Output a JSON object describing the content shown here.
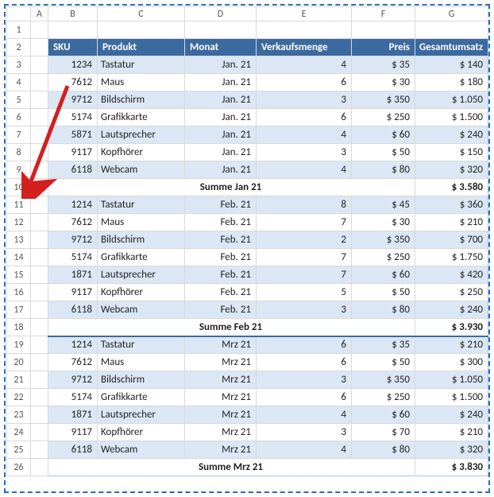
{
  "columns": [
    "A",
    "B",
    "C",
    "D",
    "E",
    "F",
    "G"
  ],
  "header": {
    "sku": "SKU",
    "produkt": "Produkt",
    "monat": "Monat",
    "menge": "Verkaufsmenge",
    "preis": "Preis",
    "umsatz": "Gesamtumsatz"
  },
  "rows": [
    {
      "n": 3,
      "sku": "1234",
      "produkt": "Tastatur",
      "monat": "Jan. 21",
      "menge": "4",
      "preis": "$ 35",
      "umsatz": "$ 140"
    },
    {
      "n": 4,
      "sku": "7612",
      "produkt": "Maus",
      "monat": "Jan. 21",
      "menge": "6",
      "preis": "$ 30",
      "umsatz": "$ 180"
    },
    {
      "n": 5,
      "sku": "9712",
      "produkt": "Bildschirm",
      "monat": "Jan. 21",
      "menge": "3",
      "preis": "$ 350",
      "umsatz": "$ 1.050"
    },
    {
      "n": 6,
      "sku": "5174",
      "produkt": "Grafikkarte",
      "monat": "Jan. 21",
      "menge": "6",
      "preis": "$ 250",
      "umsatz": "$ 1.500"
    },
    {
      "n": 7,
      "sku": "5871",
      "produkt": "Lautsprecher",
      "monat": "Jan. 21",
      "menge": "4",
      "preis": "$ 60",
      "umsatz": "$ 240"
    },
    {
      "n": 8,
      "sku": "9117",
      "produkt": "Kopfhörer",
      "monat": "Jan. 21",
      "menge": "3",
      "preis": "$ 50",
      "umsatz": "$ 150"
    },
    {
      "n": 9,
      "sku": "6118",
      "produkt": "Webcam",
      "monat": "Jan. 21",
      "menge": "4",
      "preis": "$ 80",
      "umsatz": "$ 320"
    },
    {
      "n": 10,
      "subtotal": true,
      "label": "Summe Jan 21",
      "umsatz": "$ 3.580"
    },
    {
      "n": 11,
      "sku": "1214",
      "produkt": "Tastatur",
      "monat": "Feb. 21",
      "menge": "8",
      "preis": "$ 45",
      "umsatz": "$ 360"
    },
    {
      "n": 12,
      "sku": "7612",
      "produkt": "Maus",
      "monat": "Feb. 21",
      "menge": "7",
      "preis": "$ 30",
      "umsatz": "$ 210"
    },
    {
      "n": 13,
      "sku": "9712",
      "produkt": "Bildschirm",
      "monat": "Feb. 21",
      "menge": "2",
      "preis": "$ 350",
      "umsatz": "$ 700"
    },
    {
      "n": 14,
      "sku": "5174",
      "produkt": "Grafikkarte",
      "monat": "Feb. 21",
      "menge": "7",
      "preis": "$ 250",
      "umsatz": "$ 1.750"
    },
    {
      "n": 15,
      "sku": "1871",
      "produkt": "Lautsprecher",
      "monat": "Feb. 21",
      "menge": "7",
      "preis": "$ 60",
      "umsatz": "$ 420"
    },
    {
      "n": 16,
      "sku": "9117",
      "produkt": "Kopfhörer",
      "monat": "Feb. 21",
      "menge": "5",
      "preis": "$ 50",
      "umsatz": "$ 250"
    },
    {
      "n": 17,
      "sku": "6118",
      "produkt": "Webcam",
      "monat": "Feb. 21",
      "menge": "3",
      "preis": "$ 80",
      "umsatz": "$ 240"
    },
    {
      "n": 18,
      "subtotal": true,
      "label": "Summe Feb 21",
      "umsatz": "$ 3.930"
    },
    {
      "n": 19,
      "sku": "1214",
      "produkt": "Tastatur",
      "monat": "Mrz 21",
      "menge": "6",
      "preis": "$ 35",
      "umsatz": "$ 210"
    },
    {
      "n": 20,
      "sku": "7612",
      "produkt": "Maus",
      "monat": "Mrz 21",
      "menge": "6",
      "preis": "$ 50",
      "umsatz": "$ 300"
    },
    {
      "n": 21,
      "sku": "9712",
      "produkt": "Bildschirm",
      "monat": "Mrz 21",
      "menge": "3",
      "preis": "$ 350",
      "umsatz": "$ 1.050"
    },
    {
      "n": 22,
      "sku": "5174",
      "produkt": "Grafikkarte",
      "monat": "Mrz 21",
      "menge": "6",
      "preis": "$ 250",
      "umsatz": "$ 1.500"
    },
    {
      "n": 23,
      "sku": "1871",
      "produkt": "Lautsprecher",
      "monat": "Mrz 21",
      "menge": "4",
      "preis": "$ 60",
      "umsatz": "$ 240"
    },
    {
      "n": 24,
      "sku": "9117",
      "produkt": "Kopfhörer",
      "monat": "Mrz 21",
      "menge": "3",
      "preis": "$ 70",
      "umsatz": "$ 210"
    },
    {
      "n": 25,
      "sku": "6118",
      "produkt": "Webcam",
      "monat": "Mrz 21",
      "menge": "4",
      "preis": "$ 80",
      "umsatz": "$ 320"
    },
    {
      "n": 26,
      "subtotal": true,
      "label": "Summe Mrz 21",
      "umsatz": "$ 3.830"
    }
  ],
  "rowNumbers": [
    1,
    2,
    3,
    4,
    5,
    6,
    7,
    8,
    9,
    10,
    11,
    12,
    13,
    14,
    15,
    16,
    17,
    18,
    19,
    20,
    21,
    22,
    23,
    24,
    25,
    26
  ]
}
